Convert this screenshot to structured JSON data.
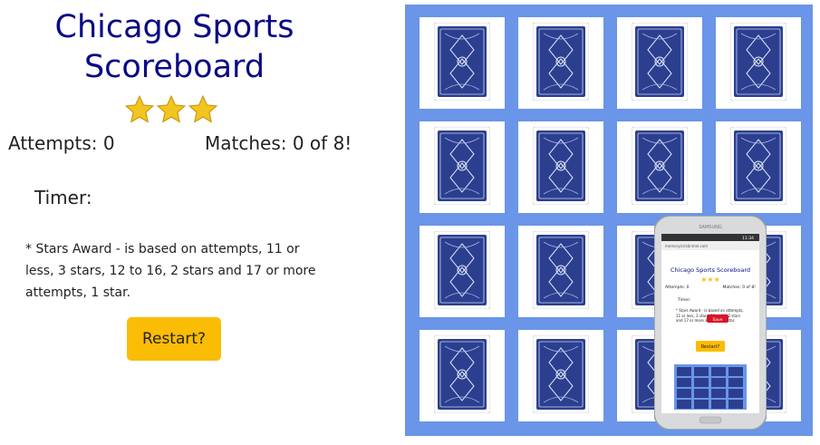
{
  "header": {
    "title_line1": "Chicago Sports",
    "title_line2": "Scoreboard"
  },
  "stars": {
    "count": 3,
    "icon": "star-icon",
    "color": "#f2c41f"
  },
  "stats": {
    "attempts_label": "Attempts: 0",
    "matches_label": "Matches: 0 of 8!"
  },
  "timer": {
    "label": "Timer:"
  },
  "note": {
    "text": "* Stars Award - is based on attempts, 11 or less, 3 stars, 12 to 16, 2 stars and 17 or more attempts, 1 star."
  },
  "controls": {
    "restart_label": "Restart?"
  },
  "board": {
    "background_color": "#6a95e8",
    "card_back_color": "#2c3f8f",
    "card_count": 16,
    "card_state": "face-down"
  },
  "phone_overlay": {
    "brand": "SAMSUNG",
    "time": "11:34",
    "url": "memory.kristinmel.com",
    "title": "Chicago Sports Scoreboard",
    "attempts": "Attempts: 0",
    "matches": "Matches: 0 of 8!",
    "timer": "Timer:",
    "note": "* Stars Award - is based on attempts, 11 or less, 3 stars, 12 to 16, 2 stars and 17 or more attempts, 1 star.",
    "save_label": "Save",
    "restart": "Restart?"
  }
}
